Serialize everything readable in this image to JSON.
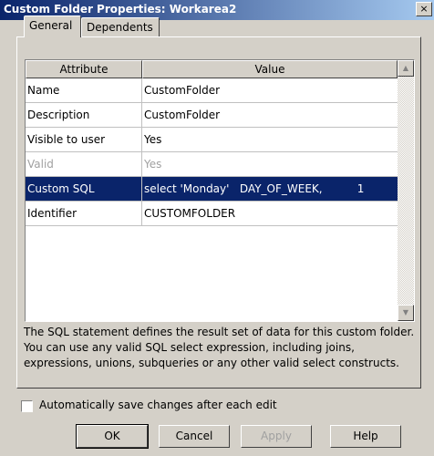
{
  "window": {
    "title": "Custom Folder Properties: Workarea2",
    "close_glyph": "×"
  },
  "tabs": [
    {
      "label": "General",
      "active": true
    },
    {
      "label": "Dependents",
      "active": false
    }
  ],
  "grid": {
    "columns": [
      "Attribute",
      "Value"
    ],
    "rows": [
      {
        "attribute": "Name",
        "value": "CustomFolder"
      },
      {
        "attribute": "Description",
        "value": "CustomFolder"
      },
      {
        "attribute": "Visible to user",
        "value": "Yes"
      },
      {
        "attribute": "Valid",
        "value": "Yes",
        "disabled": true
      },
      {
        "attribute": "Custom SQL",
        "value": "select 'Monday'   DAY_OF_WEEK,          1",
        "selected": true
      },
      {
        "attribute": "Identifier",
        "value": "CUSTOMFOLDER"
      }
    ],
    "scroll_up": "▲",
    "scroll_down": "▼"
  },
  "description": "The SQL statement defines the result set of data for this custom folder. You can use any valid SQL select expression, including joins, expressions, unions, subqueries or any other valid select constructs.",
  "autosave": {
    "label": "Automatically save changes after each edit",
    "checked": false
  },
  "buttons": {
    "ok": "OK",
    "cancel": "Cancel",
    "apply": "Apply",
    "help": "Help"
  },
  "colors": {
    "selection": "#0a246a",
    "title_start": "#0a246a",
    "title_end": "#a6caf0",
    "face": "#d4d0c8"
  }
}
